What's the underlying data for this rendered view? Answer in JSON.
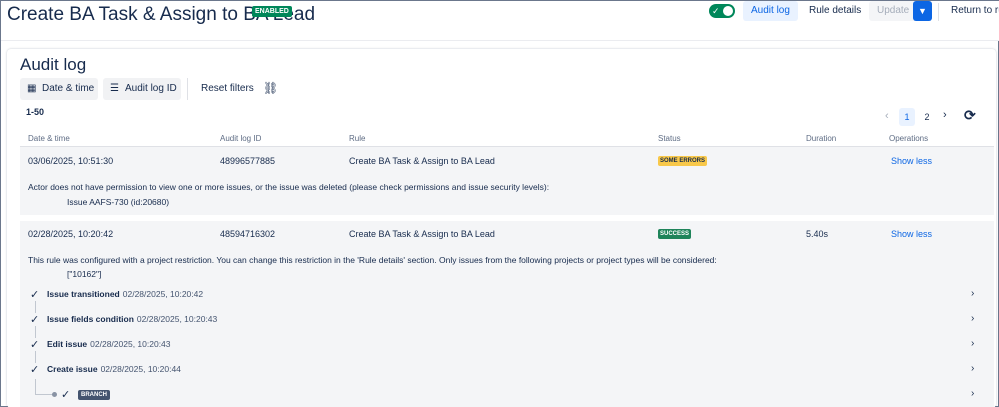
{
  "header": {
    "title": "Create BA Task & Assign to BA Lead",
    "enabled_badge": "ENABLED",
    "toggle_on": true,
    "audit_log_tab": "Audit log",
    "rule_details_tab": "Rule details",
    "update_button": "Update",
    "return_button": "Return to ru"
  },
  "main": {
    "heading": "Audit log",
    "filters": {
      "date_time": "Date & time",
      "audit_log_id": "Audit log ID",
      "reset": "Reset filters"
    },
    "range": "1-50",
    "pagination": {
      "pages": [
        "1",
        "2"
      ],
      "current": "1"
    }
  },
  "table": {
    "columns": [
      "Date & time",
      "Audit log ID",
      "Rule",
      "Status",
      "Duration",
      "Operations"
    ],
    "rows": [
      {
        "date": "03/06/2025, 10:51:30",
        "id": "48996577885",
        "rule": "Create BA Task & Assign to BA Lead",
        "status": "SOME ERRORS",
        "duration": "",
        "operation": "Show less",
        "message": "Actor does not have permission to view one or more issues, or the issue was deleted (please check permissions and issue security levels):",
        "detail": "Issue AAFS-730 (id:20680)"
      },
      {
        "date": "02/28/2025, 10:20:42",
        "id": "48594716302",
        "rule": "Create BA Task & Assign to BA Lead",
        "status": "SUCCESS",
        "duration": "5.40s",
        "operation": "Show less",
        "message": "This rule was configured with a project restriction. You can change this restriction in the 'Rule details' section. Only issues from the following projects or project types will be considered:",
        "detail": "[\"10162\"]",
        "steps": [
          {
            "name": "Issue transitioned",
            "time": "02/28/2025, 10:20:42"
          },
          {
            "name": "Issue fields condition",
            "time": "02/28/2025, 10:20:43"
          },
          {
            "name": "Edit issue",
            "time": "02/28/2025, 10:20:43"
          },
          {
            "name": "Create issue",
            "time": "02/28/2025, 10:20:44"
          }
        ],
        "branch_label": "BRANCH"
      }
    ]
  },
  "colors": {
    "accent": "#0c66e4",
    "success": "#1f845a",
    "warning": "#f8c84a",
    "enabled": "#00875a"
  }
}
